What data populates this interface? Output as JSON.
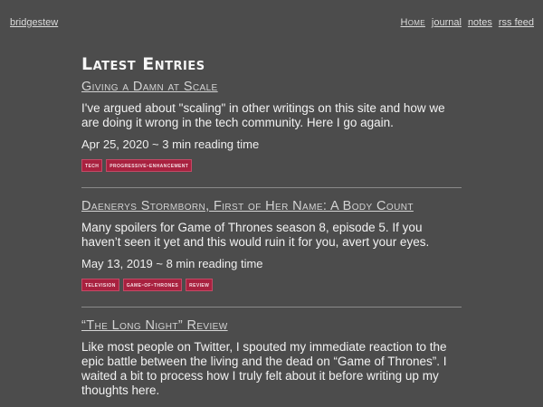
{
  "nav": {
    "site_name": "bridgestew",
    "links": [
      "Home",
      "journal",
      "notes",
      "rss feed"
    ]
  },
  "main": {
    "heading": "Latest Entries",
    "entries": [
      {
        "title": "Giving a Damn at Scale",
        "summary": "I've argued about \"scaling\" in other writings on this site and how we are doing it wrong in the tech community. Here I go again.",
        "meta": "Apr 25, 2020 ~ 3 min reading time",
        "tags": [
          "tech",
          "progressive-enhancement"
        ]
      },
      {
        "title": "Daenerys Stormborn, First of Her Name: A Body Count",
        "summary": "Many spoilers for Game of Thrones season 8, episode 5. If you haven’t seen it yet and this would ruin it for you, avert your eyes.",
        "meta": "May 13, 2019 ~ 8 min reading time",
        "tags": [
          "television",
          "game-of-thrones",
          "review"
        ]
      },
      {
        "title": "“The Long Night” Review",
        "summary": "Like most people on Twitter, I spouted my immediate reaction to the epic battle between the living and the dead on “Game of Thrones”. I waited a bit to process how I truly felt about it before writing up my thoughts here."
      }
    ]
  },
  "colors": {
    "background": "#4c4c4c",
    "tag_background": "#a8213f",
    "text": "#f0f0f0",
    "link": "#dcdcdc"
  }
}
